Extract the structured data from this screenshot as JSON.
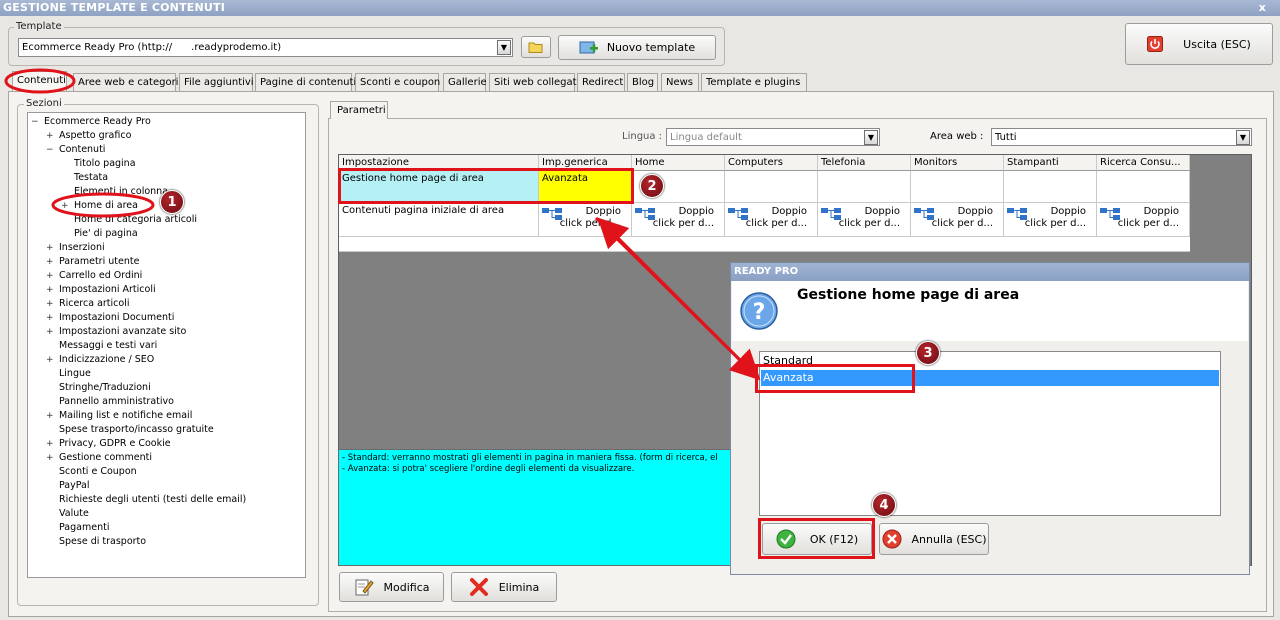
{
  "window": {
    "title": "GESTIONE TEMPLATE E CONTENUTI",
    "close": "x"
  },
  "template_group": {
    "label": "Template",
    "value": "Ecommerce Ready Pro (http://      .readyprodemo.it)"
  },
  "toolbar": {
    "new_template": "Nuovo template",
    "exit": "Uscita (ESC)"
  },
  "tabs": [
    "Contenuti",
    "Aree web e categorie",
    "File aggiuntivi",
    "Pagine di contenuti",
    "Sconti e coupon",
    "Gallerie",
    "Siti web collegati",
    "Redirect",
    "Blog",
    "News",
    "Template e plugins"
  ],
  "sections": {
    "label": "Sezioni",
    "tree": [
      {
        "label": "Ecommerce Ready Pro",
        "exp": "−"
      },
      {
        "label": "Aspetto grafico",
        "exp": "+"
      },
      {
        "label": "Contenuti",
        "exp": "−"
      },
      {
        "label": "Titolo pagina",
        "exp": ""
      },
      {
        "label": "Testata",
        "exp": ""
      },
      {
        "label": "Elementi in colonna",
        "exp": ""
      },
      {
        "label": "Home di area",
        "exp": "+"
      },
      {
        "label": "Home di categoria articoli",
        "exp": ""
      },
      {
        "label": "Pie' di pagina",
        "exp": ""
      },
      {
        "label": "Inserzioni",
        "exp": "+"
      },
      {
        "label": "Parametri utente",
        "exp": "+"
      },
      {
        "label": "Carrello ed Ordini",
        "exp": "+"
      },
      {
        "label": "Impostazioni Articoli",
        "exp": "+"
      },
      {
        "label": "Ricerca articoli",
        "exp": "+"
      },
      {
        "label": "Impostazioni Documenti",
        "exp": "+"
      },
      {
        "label": "Impostazioni avanzate sito",
        "exp": "+"
      },
      {
        "label": "Messaggi e testi vari",
        "exp": ""
      },
      {
        "label": "Indicizzazione / SEO",
        "exp": "+"
      },
      {
        "label": "Lingue",
        "exp": ""
      },
      {
        "label": "Stringhe/Traduzioni",
        "exp": ""
      },
      {
        "label": "Pannello amministrativo",
        "exp": ""
      },
      {
        "label": "Mailing list e notifiche email",
        "exp": "+"
      },
      {
        "label": "Spese trasporto/incasso gratuite",
        "exp": ""
      },
      {
        "label": "Privacy, GDPR e Cookie",
        "exp": "+"
      },
      {
        "label": "Gestione commenti",
        "exp": "+"
      },
      {
        "label": "Sconti e Coupon",
        "exp": ""
      },
      {
        "label": "PayPal",
        "exp": ""
      },
      {
        "label": "Richieste degli utenti (testi delle email)",
        "exp": ""
      },
      {
        "label": "Valute",
        "exp": ""
      },
      {
        "label": "Pagamenti",
        "exp": ""
      },
      {
        "label": "Spese di trasporto",
        "exp": ""
      }
    ]
  },
  "params": {
    "tab": "Parametri",
    "lingua_label": "Lingua :",
    "lingua_value": "Lingua default",
    "area_label": "Area web :",
    "area_value": "Tutti",
    "columns": [
      "Impostazione",
      "Imp.generica",
      "Home",
      "Computers",
      "Telefonia",
      "Monitors",
      "Stampanti",
      "Ricerca Consu..."
    ],
    "row1": {
      "name": "Gestione home page di area",
      "value": "Avanzata"
    },
    "row2": {
      "name": "Contenuti pagina iniziale di area",
      "cell_line1": "Doppio",
      "cell_line2": "click per d..."
    },
    "description": [
      "- Standard: verranno mostrati gli elementi in pagina in maniera fissa. (form di ricerca, el",
      "- Avanzata: si potra' scegliere l'ordine degli elementi da visualizzare."
    ],
    "modify": "Modifica",
    "delete": "Elimina"
  },
  "dialog": {
    "title": "READY PRO",
    "heading": "Gestione home page di area",
    "options": [
      "Standard",
      "Avanzata"
    ],
    "ok": "OK (F12)",
    "cancel": "Annulla (ESC)"
  },
  "badges": [
    "1",
    "2",
    "3",
    "4"
  ],
  "colors": {
    "highlight_cyan": "#b4f0f4",
    "highlight_yellow": "#ffff00",
    "desc_cyan": "#00ffff",
    "selection_blue": "#3399ff",
    "annotation_red": "#e0121a"
  }
}
